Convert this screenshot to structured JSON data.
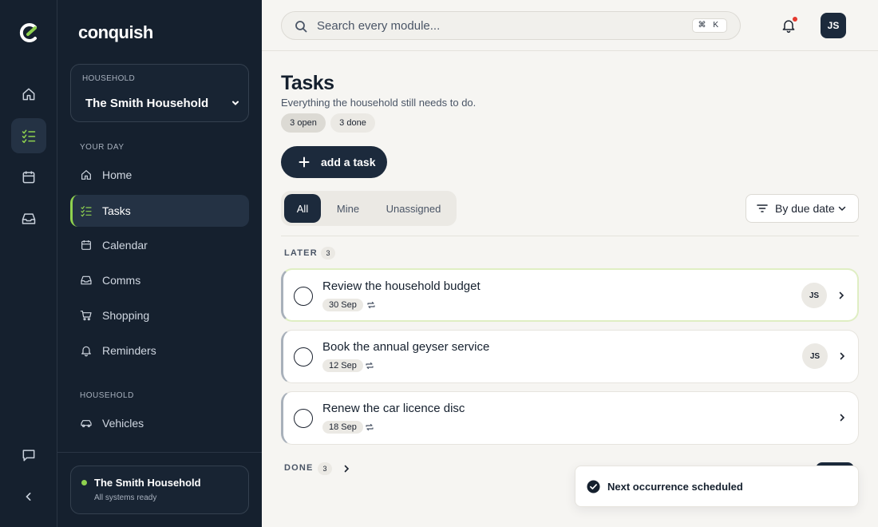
{
  "brand": {
    "name": "conquish"
  },
  "rail": {
    "icons": [
      "home-icon",
      "tasks-icon",
      "calendar-icon",
      "inbox-icon",
      "chat-icon",
      "collapse-icon"
    ]
  },
  "sidebar": {
    "household_label": "HOUSEHOLD",
    "household_value": "The Smith Household",
    "sections": {
      "your_day": "YOUR DAY",
      "household": "HOUSEHOLD"
    },
    "your_day_items": [
      {
        "label": "Home",
        "icon": "home-icon"
      },
      {
        "label": "Tasks",
        "icon": "checklist-icon",
        "active": true
      },
      {
        "label": "Calendar",
        "icon": "calendar-icon"
      },
      {
        "label": "Comms",
        "icon": "inbox-icon"
      },
      {
        "label": "Shopping",
        "icon": "cart-icon"
      },
      {
        "label": "Reminders",
        "icon": "bell-icon"
      }
    ],
    "household_items": [
      {
        "label": "Vehicles",
        "icon": "car-icon"
      }
    ],
    "status": {
      "title": "The Smith Household",
      "subtitle": "All systems ready"
    }
  },
  "topbar": {
    "search_placeholder": "Search every module...",
    "shortcut": "⌘ K",
    "avatar_initials": "JS"
  },
  "page": {
    "title": "Tasks",
    "subtitle": "Everything the household still needs to do.",
    "chips": {
      "open": "3 open",
      "done": "3 done"
    },
    "add_label": "add a task",
    "tabs": [
      "All",
      "Mine",
      "Unassigned"
    ],
    "sort_label": "By due date"
  },
  "groups": {
    "later": {
      "label": "LATER",
      "count": "3"
    },
    "done": {
      "label": "DONE",
      "count": "3"
    }
  },
  "tasks": [
    {
      "name": "Review the household budget",
      "date": "30 Sep",
      "assignee": "JS",
      "recurring": true
    },
    {
      "name": "Book the annual geyser service",
      "date": "12 Sep",
      "assignee": "JS",
      "recurring": true
    },
    {
      "name": "Renew the car licence disc",
      "date": "18 Sep",
      "assignee": "",
      "recurring": true
    }
  ],
  "toast": {
    "message": "Next occurrence scheduled"
  },
  "colors": {
    "accent": "#8fd24f",
    "navy": "#15202e",
    "alert": "#e5392f"
  }
}
